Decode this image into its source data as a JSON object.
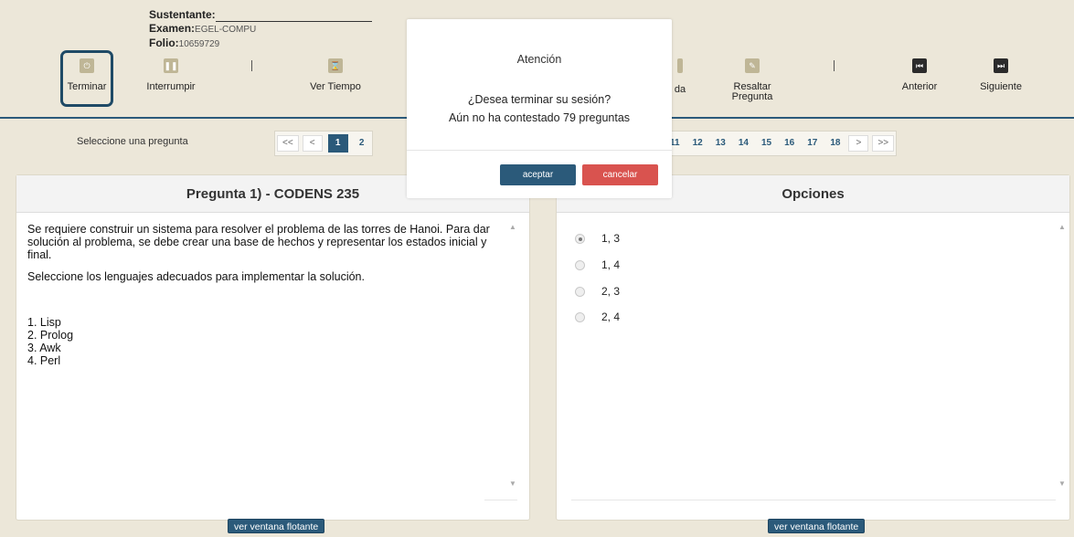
{
  "header": {
    "sustentante_label": "Sustentante:",
    "examen_label": "Examen:",
    "examen_value": "EGEL-COMPU",
    "folio_label": "Folio:",
    "folio_value": "10659729"
  },
  "toolbar": {
    "terminar": "Terminar",
    "interrumpir": "Interrumpir",
    "ver_tiempo": "Ver Tiempo",
    "ayuda_partial": "da",
    "resaltar_line1": "Resaltar",
    "resaltar_line2": "Pregunta",
    "anterior": "Anterior",
    "siguiente": "Siguiente"
  },
  "pager": {
    "label": "Seleccione una pregunta",
    "first": "<<",
    "prev": "<",
    "left_pages": [
      "1",
      "2"
    ],
    "right_pages": [
      "11",
      "12",
      "13",
      "14",
      "15",
      "16",
      "17",
      "18"
    ],
    "next": ">",
    "last": ">>"
  },
  "question": {
    "title": "Pregunta 1) - CODENS 235",
    "paragraph1": "Se requiere construir un sistema para resolver el problema de las torres de Hanoi. Para dar solución al problema, se debe crear una base de hechos y representar los estados inicial y final.",
    "paragraph2": "Seleccione los lenguajes adecuados para implementar la solución.",
    "items": [
      "1. Lisp",
      "2. Prolog",
      "3. Awk",
      "4. Perl"
    ]
  },
  "options": {
    "title": "Opciones",
    "list": [
      "1, 3",
      "1, 4",
      "2, 3",
      "2, 4"
    ],
    "selected_index": 0
  },
  "float_button": "ver ventana flotante",
  "modal": {
    "title": "Atención",
    "line1": "¿Desea terminar su sesión?",
    "line2": "Aún no ha contestado 79 preguntas",
    "accept": "aceptar",
    "cancel": "cancelar"
  },
  "colors": {
    "accent": "#2b5a7a",
    "cancel": "#d9534f",
    "background": "#ece7d9"
  }
}
